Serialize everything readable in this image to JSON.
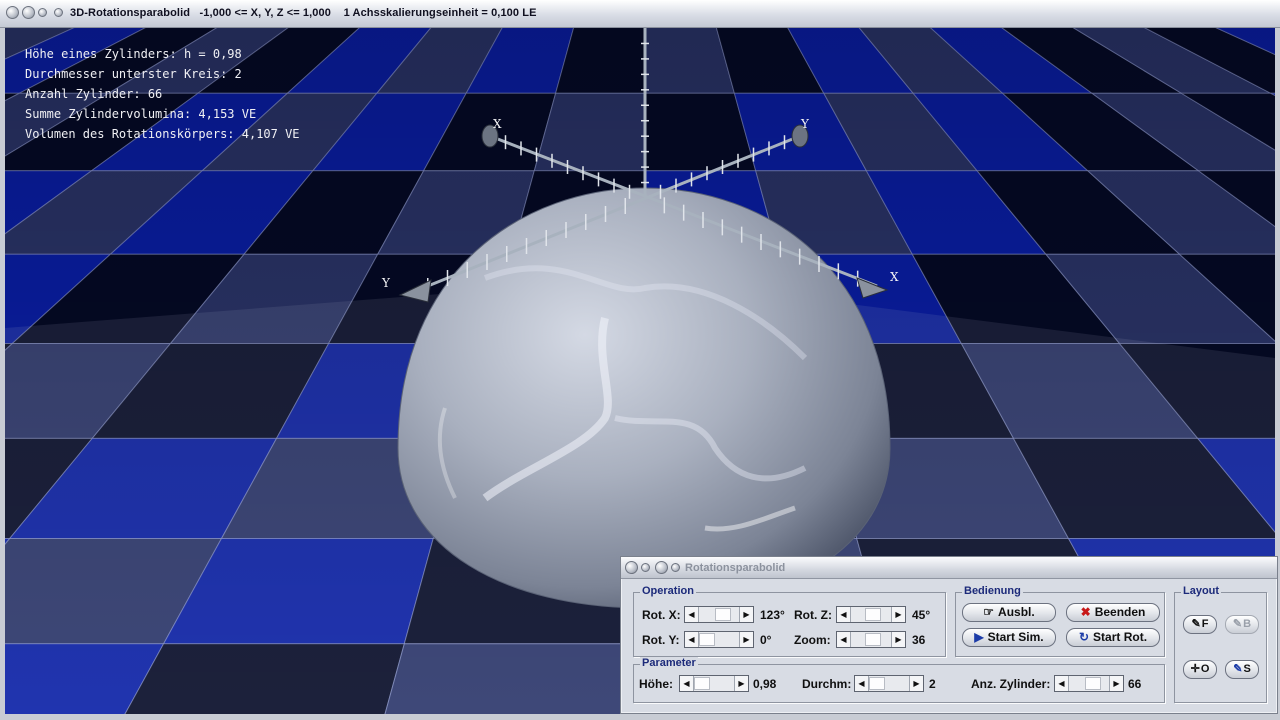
{
  "window": {
    "title": "3D-Rotationsparabolid   -1,000 <= X, Y, Z <= 1,000    1 Achsskalierungseinheit = 0,100 LE"
  },
  "info": {
    "lines": [
      "Höhe eines Zylinders: h = 0,98",
      "Durchmesser unterster Kreis: 2",
      "Anzahl Zylinder: 66",
      "Summe Zylindervolumina: 4,153 VE",
      "Volumen des Rotationskörpers: 4,107 VE"
    ]
  },
  "axes": {
    "x_label": "X",
    "y_label": "Y"
  },
  "colors": {
    "grid_blue": "#0a1fa8",
    "solid_white": "#c8d0e4",
    "floor_dark": "#050a24",
    "body": "#9ea7b8"
  },
  "dialog": {
    "title": "Rotationsparabolid",
    "operation": {
      "label": "Operation",
      "rot_x_label": "Rot. X:",
      "rot_x_value": "123°",
      "rot_y_label": "Rot. Y:",
      "rot_y_value": "0°",
      "rot_z_label": "Rot. Z:",
      "rot_z_value": "45°",
      "zoom_label": "Zoom:",
      "zoom_value": "36"
    },
    "bedienung": {
      "label": "Bedienung",
      "ausbl": "Ausbl.",
      "beenden": "Beenden",
      "start_sim": "Start Sim.",
      "start_rot": "Start Rot."
    },
    "layout": {
      "label": "Layout",
      "f": "F",
      "b": "B",
      "o": "O",
      "s": "S"
    },
    "parameter": {
      "label": "Parameter",
      "hoehe_label": "Höhe:",
      "hoehe_value": "0,98",
      "durchm_label": "Durchm:",
      "durchm_value": "2",
      "anz_label": "Anz. Zylinder:",
      "anz_value": "66"
    }
  }
}
